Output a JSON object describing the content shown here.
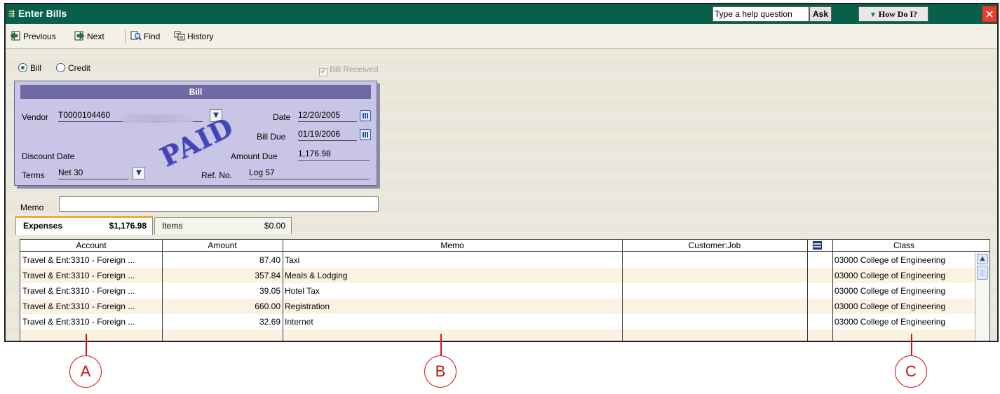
{
  "window": {
    "title": "Enter Bills",
    "help_placeholder": "Type a help question",
    "ask_label": "Ask",
    "how_do_i_label": "How Do I?",
    "close_glyph": "✕"
  },
  "toolbar": {
    "previous_label": "Previous",
    "next_label": "Next",
    "find_label": "Find",
    "history_label": "History"
  },
  "bill_type": {
    "bill_label": "Bill",
    "credit_label": "Credit",
    "selected": "Bill",
    "bill_received_label": "Bill Received",
    "bill_received_checked": true
  },
  "bill": {
    "header": "Bill",
    "vendor_label": "Vendor",
    "vendor_value": "T0000104460",
    "date_label": "Date",
    "date_value": "12/20/2005",
    "bill_due_label": "Bill Due",
    "bill_due_value": "01/19/2006",
    "amount_due_label": "Amount Due",
    "amount_due_value": "1,176.98",
    "discount_date_label": "Discount Date",
    "terms_label": "Terms",
    "terms_value": "Net 30",
    "ref_no_label": "Ref. No.",
    "ref_no_value": "Log 57",
    "stamp": "PAID"
  },
  "memo": {
    "label": "Memo",
    "value": ""
  },
  "tabs": [
    {
      "label": "Expenses",
      "amount": "$1,176.98",
      "active": true
    },
    {
      "label": "Items",
      "amount": "$0.00",
      "active": false
    }
  ],
  "grid": {
    "columns": [
      "Account",
      "Amount",
      "Memo",
      "Customer:Job",
      "Class"
    ],
    "rows": [
      {
        "account": "Travel & Ent:3310 - Foreign ...",
        "amount": "87.40",
        "memo": "Taxi",
        "customer_job": "",
        "class": "03000 College of Engineering"
      },
      {
        "account": "Travel & Ent:3310 - Foreign ...",
        "amount": "357.84",
        "memo": "Meals & Lodging",
        "customer_job": "",
        "class": "03000 College of Engineering"
      },
      {
        "account": "Travel & Ent:3310 - Foreign ...",
        "amount": "39.05",
        "memo": "Hotel Tax",
        "customer_job": "",
        "class": "03000 College of Engineering"
      },
      {
        "account": "Travel & Ent:3310 - Foreign ...",
        "amount": "660.00",
        "memo": "Registration",
        "customer_job": "",
        "class": "03000 College of Engineering"
      },
      {
        "account": "Travel & Ent:3310 - Foreign ...",
        "amount": "32.69",
        "memo": "Internet",
        "customer_job": "",
        "class": "03000 College of Engineering"
      }
    ]
  },
  "annotations": [
    "A",
    "B",
    "C"
  ],
  "colors": {
    "title_bar": "#08604a",
    "bill_panel": "#c9c5e6",
    "bill_header": "#6f6aa3",
    "paid_stamp": "#2a2fb0",
    "active_tab_accent": "#f0a93a",
    "alt_row": "#fbf3e2",
    "annotation": "#d01818"
  }
}
